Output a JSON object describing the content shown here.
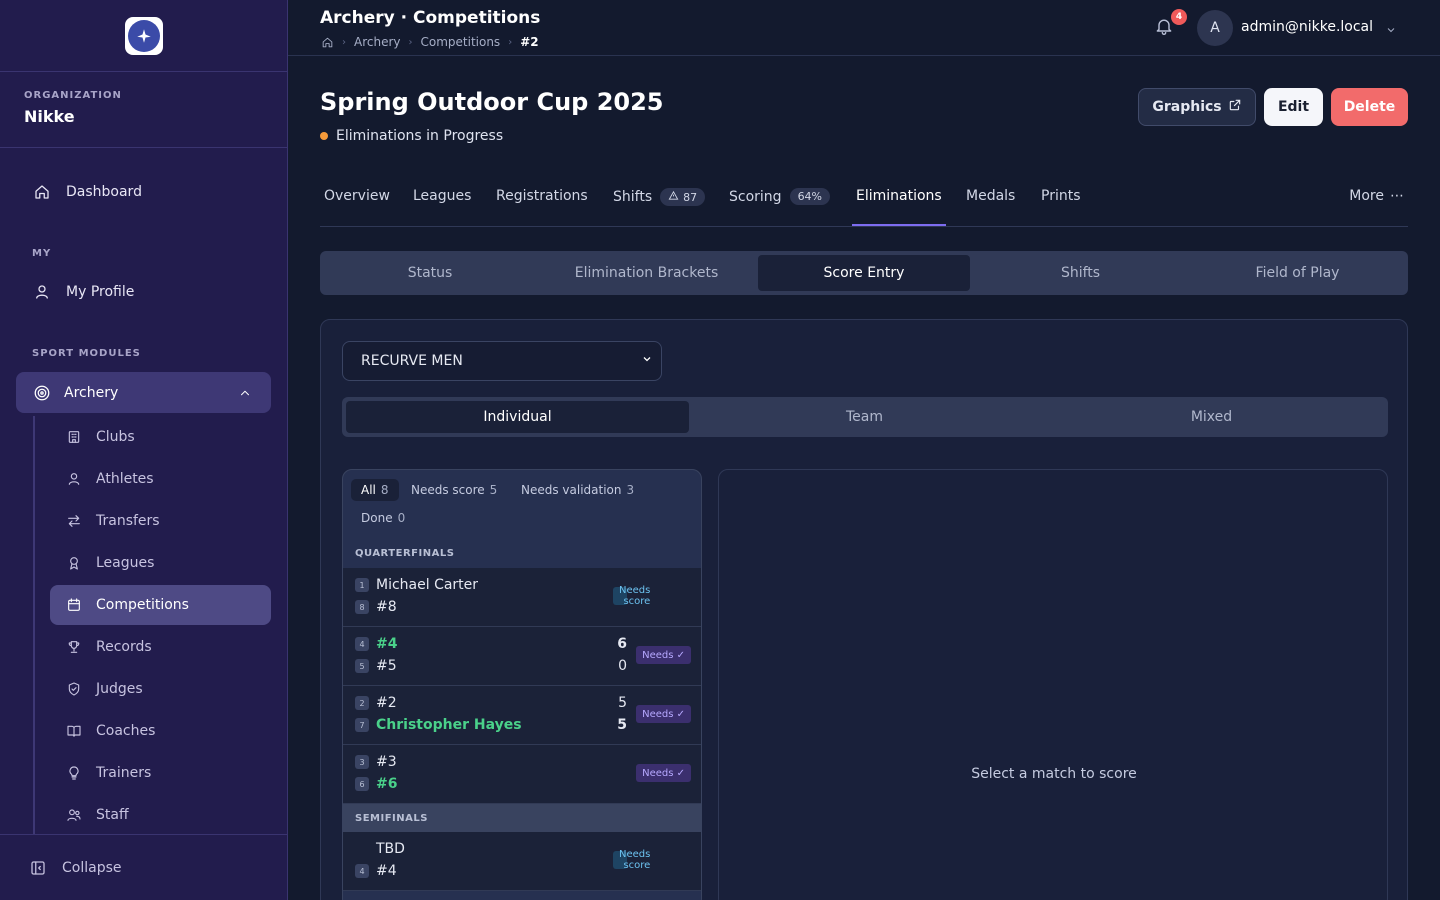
{
  "sidebar": {
    "org_caption": "ORGANIZATION",
    "org_name": "Nikke",
    "dashboard": "Dashboard",
    "my_caption": "MY",
    "my_profile": "My Profile",
    "sport_caption": "SPORT MODULES",
    "archery": "Archery",
    "items": [
      {
        "label": "Clubs",
        "icon": "building-icon"
      },
      {
        "label": "Athletes",
        "icon": "user-icon"
      },
      {
        "label": "Transfers",
        "icon": "arrows-icon"
      },
      {
        "label": "Leagues",
        "icon": "ribbon-icon"
      },
      {
        "label": "Competitions",
        "icon": "calendar-icon"
      },
      {
        "label": "Records",
        "icon": "trophy-icon"
      },
      {
        "label": "Judges",
        "icon": "shield-icon"
      },
      {
        "label": "Coaches",
        "icon": "book-icon"
      },
      {
        "label": "Trainers",
        "icon": "bulb-icon"
      },
      {
        "label": "Staff",
        "icon": "users-icon"
      }
    ],
    "collapse": "Collapse"
  },
  "topbar": {
    "title": "Archery · Competitions",
    "crumbs": [
      "Archery",
      "Competitions",
      "#2"
    ],
    "notifications": "4",
    "avatar_initial": "A",
    "user": "admin@nikke.local"
  },
  "page": {
    "title": "Spring Outdoor Cup 2025",
    "status": "Eliminations in Progress",
    "status_color": "#f59a3a",
    "graphics": "Graphics",
    "edit": "Edit",
    "delete": "Delete"
  },
  "tabs": {
    "overview": "Overview",
    "leagues": "Leagues",
    "registrations": "Registrations",
    "shifts": "Shifts",
    "shifts_count": "87",
    "scoring": "Scoring",
    "scoring_pct": "64%",
    "eliminations": "Eliminations",
    "medals": "Medals",
    "prints": "Prints",
    "more": "More"
  },
  "subtabs": [
    "Status",
    "Elimination Brackets",
    "Score Entry",
    "Shifts",
    "Field of Play"
  ],
  "division": "RECURVE MEN",
  "segments": [
    "Individual",
    "Team",
    "Mixed"
  ],
  "filters": {
    "all": "All",
    "all_n": "8",
    "needs_score": "Needs score",
    "needs_score_n": "5",
    "needs_validation": "Needs validation",
    "needs_validation_n": "3",
    "done": "Done",
    "done_n": "0"
  },
  "sections": {
    "quarterfinals": "QUARTERFINALS",
    "semifinals": "SEMIFINALS"
  },
  "matches": [
    {
      "a_seed": "1",
      "a_name": "Michael Carter",
      "a_score": "",
      "b_seed": "8",
      "b_name": "#8",
      "b_score": "",
      "badge": "Needs score"
    },
    {
      "a_seed": "4",
      "a_name": "#4",
      "a_score": "6",
      "b_seed": "5",
      "b_name": "#5",
      "b_score": "0",
      "badge": "Needs ✓"
    },
    {
      "a_seed": "2",
      "a_name": "#2",
      "a_score": "5",
      "b_seed": "7",
      "b_name": "Christopher Hayes",
      "b_score": "5",
      "badge": "Needs ✓"
    },
    {
      "a_seed": "3",
      "a_name": "#3",
      "a_score": "",
      "b_seed": "6",
      "b_name": "#6",
      "b_score": "",
      "badge": "Needs ✓"
    },
    {
      "a_seed": "",
      "a_name": "TBD",
      "a_score": "",
      "b_seed": "4",
      "b_name": "#4",
      "b_score": "",
      "badge": "Needs score"
    }
  ],
  "detail_placeholder": "Select a match to score"
}
